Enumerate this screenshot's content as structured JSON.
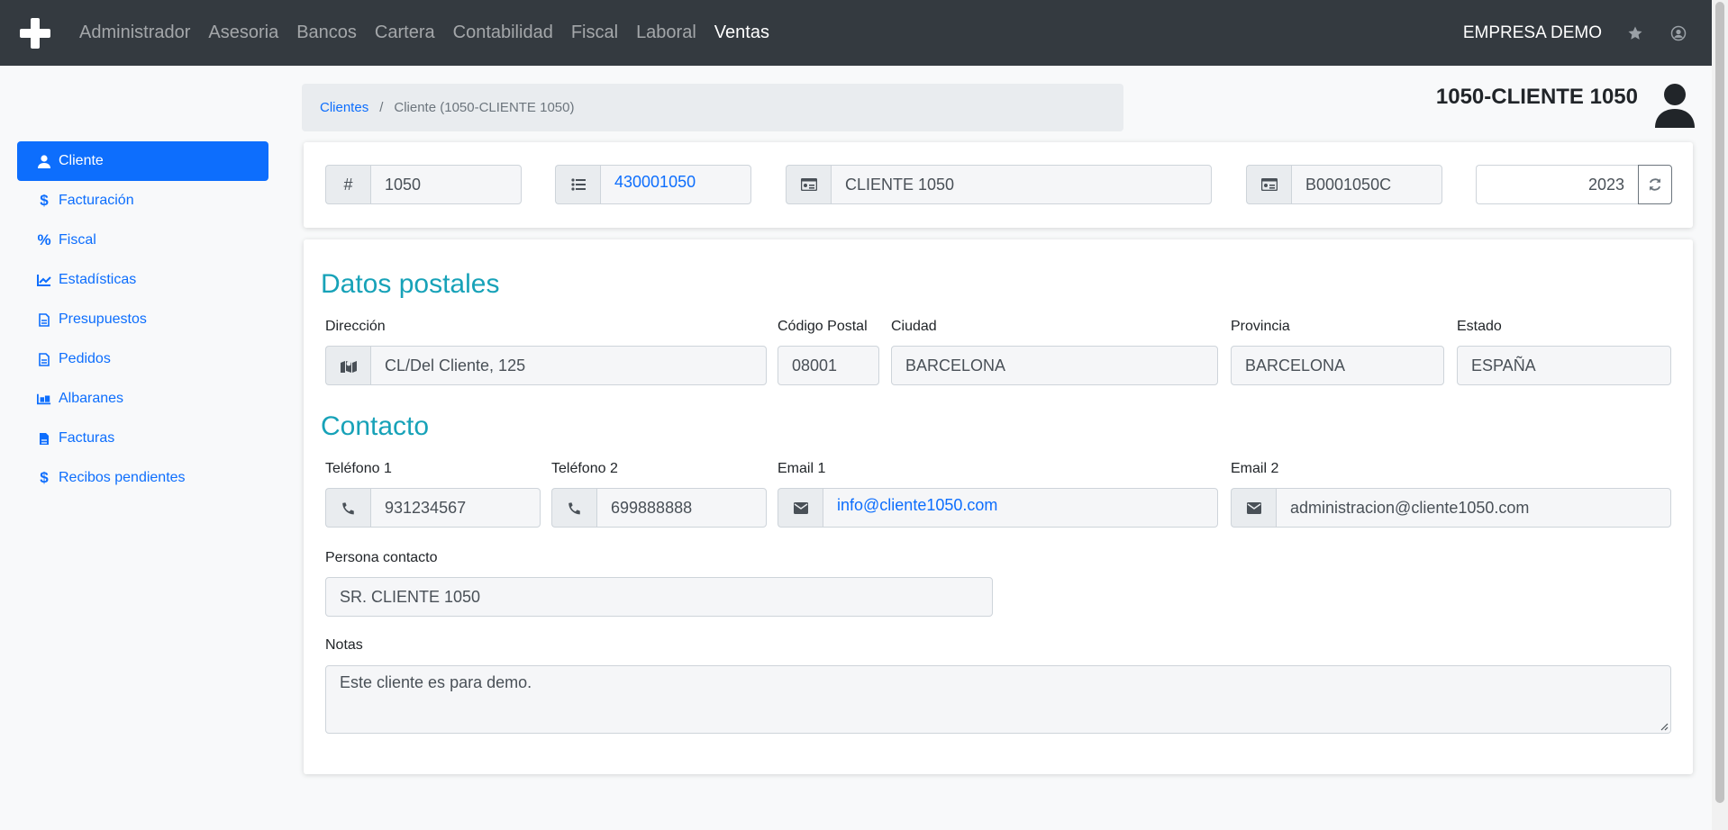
{
  "nav": {
    "items": [
      "Administrador",
      "Asesoria",
      "Bancos",
      "Cartera",
      "Contabilidad",
      "Fiscal",
      "Laboral",
      "Ventas"
    ],
    "active": "Ventas",
    "company": "EMPRESA DEMO"
  },
  "sidebar": {
    "items": [
      {
        "label": "Cliente",
        "icon": "user-icon"
      },
      {
        "label": "Facturación",
        "icon": "dollar-icon"
      },
      {
        "label": "Fiscal",
        "icon": "percent-icon"
      },
      {
        "label": "Estadísticas",
        "icon": "chart-line-icon"
      },
      {
        "label": "Presupuestos",
        "icon": "file-icon"
      },
      {
        "label": "Pedidos",
        "icon": "file-icon"
      },
      {
        "label": "Albaranes",
        "icon": "truck-loading-icon"
      },
      {
        "label": "Facturas",
        "icon": "file-invoice-icon"
      },
      {
        "label": "Recibos pendientes",
        "icon": "dollar-icon"
      }
    ],
    "active": "Cliente"
  },
  "breadcrumb": {
    "root": "Clientes",
    "sep": "/",
    "current": "Cliente (1050-CLIENTE 1050)"
  },
  "header": {
    "title": "1050-CLIENTE 1050"
  },
  "top": {
    "hash": "#",
    "code": "1050",
    "account": "430001050",
    "name": "CLIENTE 1050",
    "cif": "B0001050C",
    "year": "2023"
  },
  "postal": {
    "title": "Datos postales",
    "address_label": "Dirección",
    "address": "CL/Del Cliente, 125",
    "zip_label": "Código Postal",
    "zip": "08001",
    "city_label": "Ciudad",
    "city": "BARCELONA",
    "province_label": "Provincia",
    "province": "BARCELONA",
    "state_label": "Estado",
    "state": "ESPAÑA"
  },
  "contact": {
    "title": "Contacto",
    "phone1_label": "Teléfono 1",
    "phone1": "931234567",
    "phone2_label": "Teléfono 2",
    "phone2": "699888888",
    "email1_label": "Email 1",
    "email1": "info@cliente1050.com",
    "email2_label": "Email 2",
    "email2": "administracion@cliente1050.com",
    "person_label": "Persona contacto",
    "person": "SR. CLIENTE 1050",
    "notes_label": "Notas",
    "notes": "Este cliente es para demo."
  }
}
